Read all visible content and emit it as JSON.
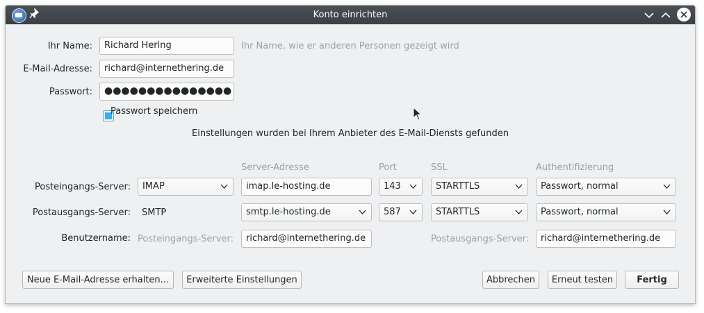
{
  "window": {
    "title": "Konto einrichten"
  },
  "form": {
    "name_label": "Ihr Name:",
    "name_value": "Richard Hering",
    "name_hint": "Ihr Name, wie er anderen Personen gezeigt wird",
    "email_label": "E-Mail-Adresse:",
    "email_value": "richard@internethering.de",
    "password_label": "Passwort:",
    "password_value": "●●●●●●●●●●●●●●●",
    "remember_label": "Passwort speichern",
    "remember_checked": true,
    "status_text": "Einstellungen wurden bei Ihrem Anbieter des E-Mail-Diensts gefunden"
  },
  "server": {
    "headers": {
      "address": "Server-Adresse",
      "port": "Port",
      "ssl": "SSL",
      "auth": "Authentifizierung"
    },
    "incoming": {
      "label": "Posteingangs-Server:",
      "protocol": "IMAP",
      "address": "imap.le-hosting.de",
      "port": "143",
      "ssl": "STARTTLS",
      "auth": "Passwort, normal"
    },
    "outgoing": {
      "label": "Postausgangs-Server:",
      "protocol": "SMTP",
      "address": "smtp.le-hosting.de",
      "port": "587",
      "ssl": "STARTTLS",
      "auth": "Passwort, normal"
    },
    "username": {
      "label": "Benutzername:",
      "incoming_hint": "Posteingangs-Server:",
      "incoming_value": "richard@internethering.de",
      "outgoing_hint": "Postausgangs-Server:",
      "outgoing_value": "richard@internethering.de"
    }
  },
  "buttons": {
    "new_address": "Neue E-Mail-Adresse erhalten...",
    "advanced": "Erweiterte Einstellungen",
    "cancel": "Abbrechen",
    "retest": "Erneut testen",
    "done": "Fertig"
  },
  "colors": {
    "titlebar": "#3b4045",
    "window_bg": "#eff0f1",
    "accent": "#3daee9",
    "hint_text": "#9da1a4"
  },
  "icons": [
    "thunderbird-app-icon",
    "pin-icon",
    "minimize-icon",
    "maximize-icon",
    "close-icon",
    "chevron-down-icon",
    "mouse-cursor-icon"
  ]
}
